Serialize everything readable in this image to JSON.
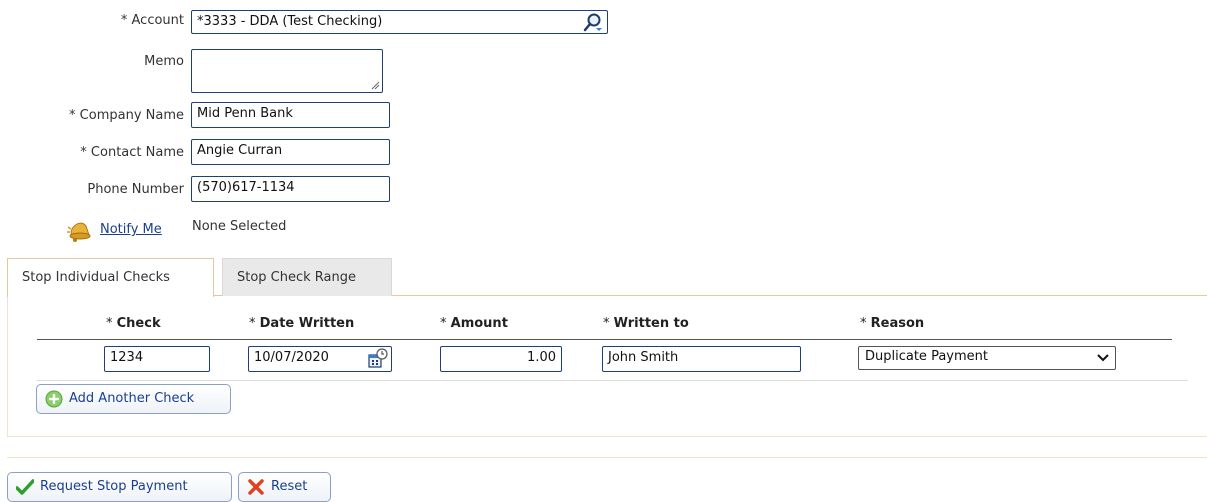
{
  "form": {
    "account": {
      "label": "* Account",
      "value": "*3333 - DDA (Test Checking)"
    },
    "memo": {
      "label": "Memo",
      "value": ""
    },
    "company_name": {
      "label": "* Company Name",
      "value": "Mid Penn Bank"
    },
    "contact_name": {
      "label": "* Contact Name",
      "value": "Angie Curran"
    },
    "phone_number": {
      "label": "Phone Number",
      "value": "(570)617-1134"
    },
    "notify": {
      "link": "Notify Me",
      "status": "None Selected"
    }
  },
  "tabs": [
    {
      "label": "Stop Individual Checks",
      "active": true
    },
    {
      "label": "Stop Check Range",
      "active": false
    }
  ],
  "table": {
    "headers": [
      {
        "star": "* ",
        "text": "Check"
      },
      {
        "star": "* ",
        "text": "Date Written"
      },
      {
        "star": "* ",
        "text": "Amount"
      },
      {
        "star": "* ",
        "text": "Written to"
      },
      {
        "star": "* ",
        "text": "Reason"
      }
    ],
    "row": {
      "check": "1234",
      "date_written": "10/07/2020",
      "amount": "1.00",
      "written_to": "John Smith",
      "reason": "Duplicate Payment"
    },
    "add_button": "Add Another Check"
  },
  "actions": {
    "submit": "Request Stop Payment",
    "reset": "Reset"
  },
  "colors": {
    "field_border": "#1f3f78",
    "link": "#1a3f8f",
    "tab_border": "#e6c79a",
    "submit_icon": "#2e9e2e",
    "reset_icon": "#e0421f"
  },
  "icons": {
    "account_lookup": "magnifier-icon",
    "notify": "bell-icon",
    "date_picker": "calendar-clock-icon",
    "reason_select": "chevron-down-icon",
    "add": "plus-circle-icon",
    "submit": "checkmark-icon",
    "reset": "x-icon"
  }
}
